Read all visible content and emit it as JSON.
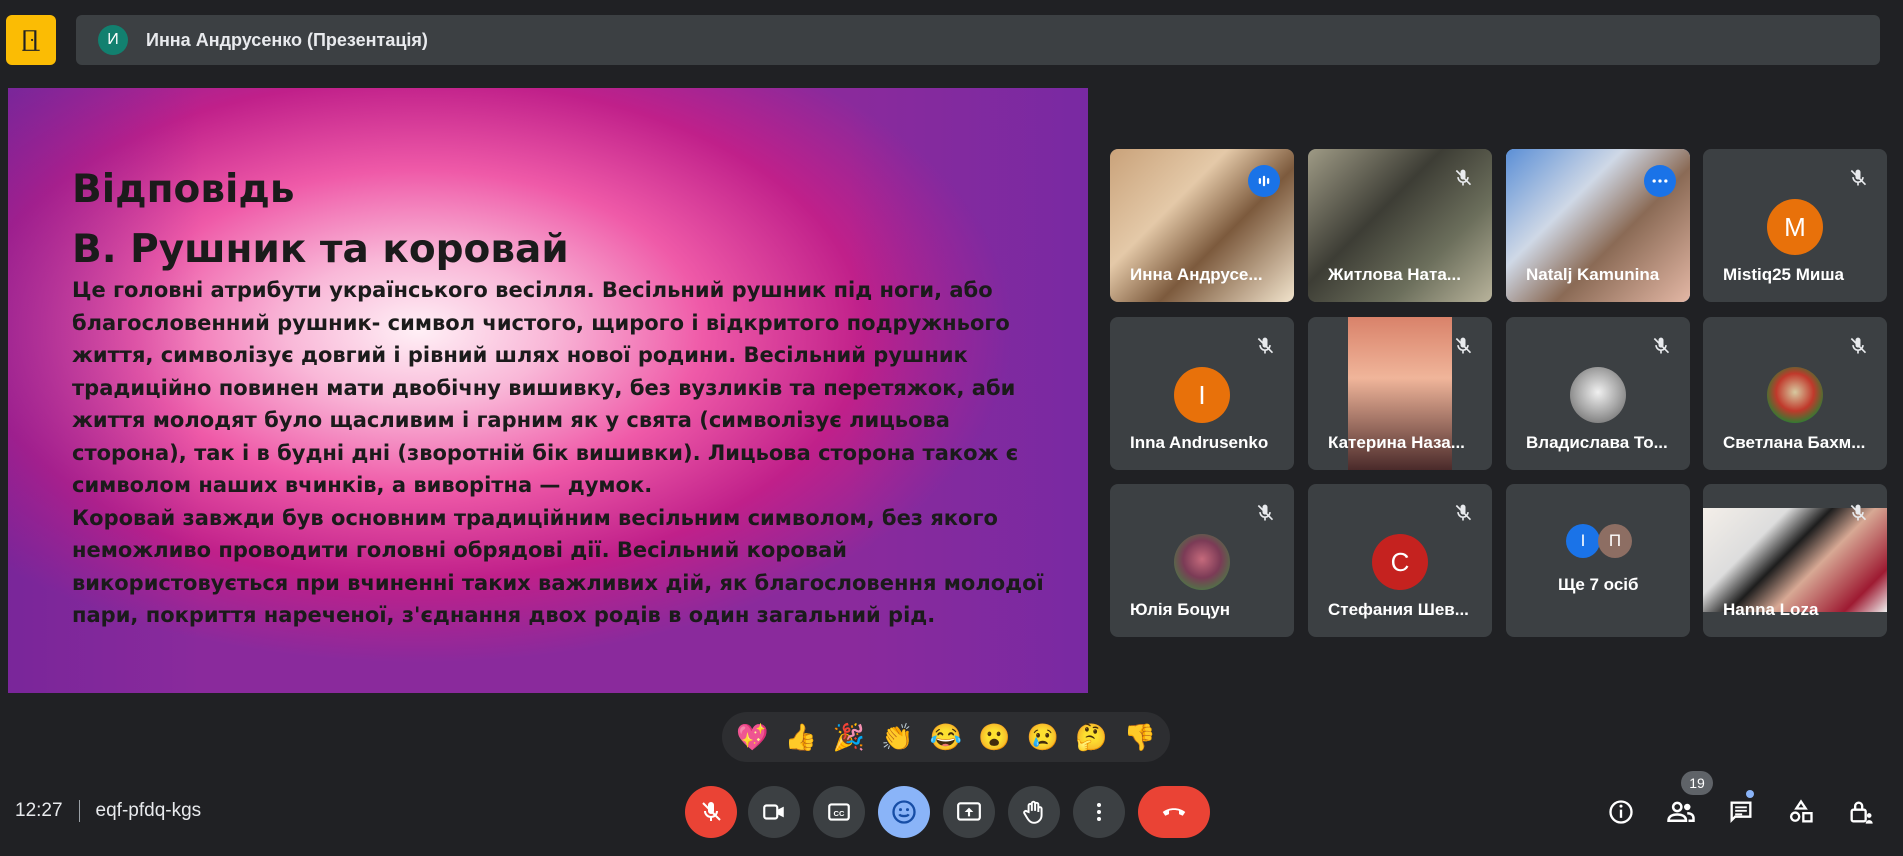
{
  "header": {
    "avatar_letter": "И",
    "title": "Инна Андрусенко (Презентація)"
  },
  "slide": {
    "heading_line1": "Відповідь",
    "heading_line2": "В. Рушник та коровай",
    "body": "Це головні атрибути українського весілля. Весільний рушник під ноги, або благословенний рушник- символ чистого, щирого і відкритого подружнього життя, символізує довгий і рівний шлях нової родини. Весільний рушник традиційно повинен мати двобічну вишивку, без вузликів та перетяжок, аби життя молодят було щасливим і гарним як у свята (символізує лицьова сторона), так і в будні дні (зворотній бік вишивки). Лицьова сторона також є символом наших вчинків, а виворітна — думок. Коровай завжди був основним традиційним весільним символом, без якого неможливо проводити головні обрядові дії. Весільний коровай використовується при вчиненні таких важливих дій, як благословення молодої пари, покриття нареченої, з'єднання двох родів в один загальний рід."
  },
  "participants": [
    {
      "name": "Инна Андрусе...",
      "type": "video",
      "speaking": true
    },
    {
      "name": "Житлова Ната...",
      "type": "video",
      "muted": true
    },
    {
      "name": "Natalj Kamunina",
      "type": "video",
      "pinned": true
    },
    {
      "name": "Mistiq25 Миша",
      "type": "avatar",
      "letter": "M",
      "color": "#e8710a",
      "muted": true
    },
    {
      "name": "Inna Andrusenko",
      "type": "avatar",
      "letter": "I",
      "color": "#e8710a",
      "muted": true
    },
    {
      "name": "Катерина Наза...",
      "type": "video",
      "muted": true
    },
    {
      "name": "Владислава То...",
      "type": "photo",
      "muted": true
    },
    {
      "name": "Светлана Бахм...",
      "type": "photo",
      "muted": true
    },
    {
      "name": "Юлія Боцун",
      "type": "photo",
      "muted": true
    },
    {
      "name": "Стефания Шев...",
      "type": "avatar",
      "letter": "C",
      "color": "#c5221f",
      "muted": true
    },
    {
      "name": "Ще 7 осіб",
      "type": "more",
      "letters": [
        "I",
        "П"
      ]
    },
    {
      "name": "Hanna Loza",
      "type": "video",
      "muted": true
    }
  ],
  "reactions": [
    "💖",
    "👍",
    "🎉",
    "👏",
    "😂",
    "😮",
    "😢",
    "🤔",
    "👎"
  ],
  "footer": {
    "time": "12:27",
    "meeting_code": "eqf-pfdq-kgs",
    "people_count": "19"
  }
}
